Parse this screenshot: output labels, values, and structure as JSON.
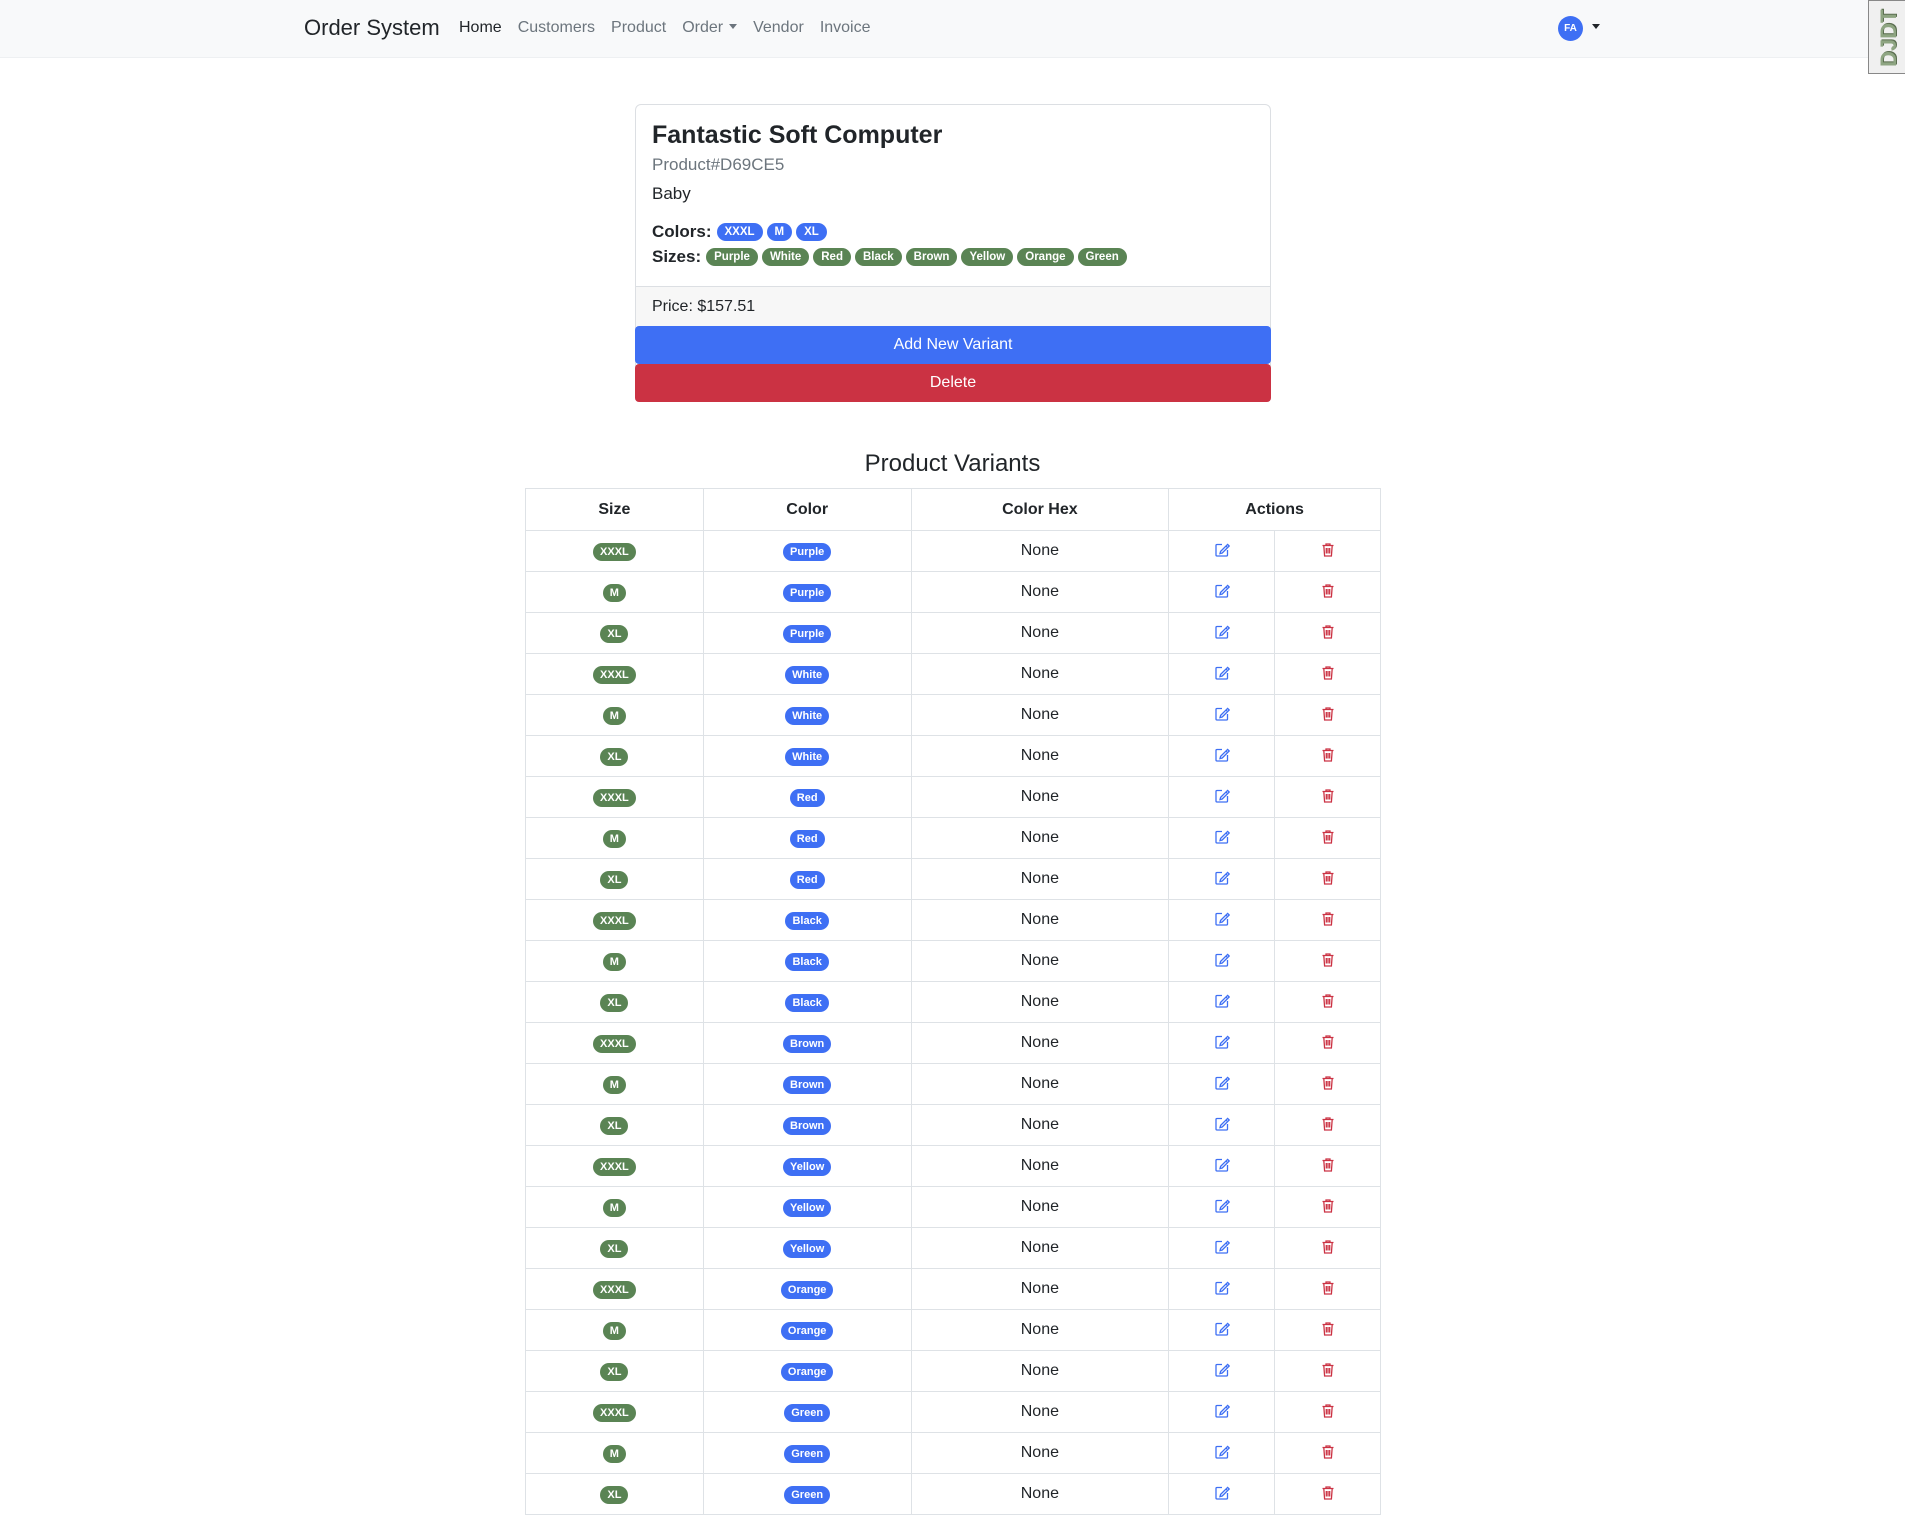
{
  "navbar": {
    "brand": "Order System",
    "links": [
      "Home",
      "Customers",
      "Product",
      "Order",
      "Vendor",
      "Invoice"
    ],
    "active": "Home",
    "avatar_initials": "FA",
    "debug_toolbar_label": "DJDT"
  },
  "product": {
    "name": "Fantastic Soft Computer",
    "code": "Product#D69CE5",
    "category": "Baby",
    "colors_label": "Colors:",
    "colors": [
      "XXXL",
      "M",
      "XL"
    ],
    "sizes_label": "Sizes:",
    "sizes": [
      "Purple",
      "White",
      "Red",
      "Black",
      "Brown",
      "Yellow",
      "Orange",
      "Green"
    ],
    "price": "Price: $157.51",
    "add_variant_label": "Add New Variant",
    "delete_label": "Delete"
  },
  "variants": {
    "title": "Product Variants",
    "columns": [
      "Size",
      "Color",
      "Color Hex",
      "Actions"
    ],
    "rows": [
      {
        "size": "XXXL",
        "color": "Purple",
        "hex": "None"
      },
      {
        "size": "M",
        "color": "Purple",
        "hex": "None"
      },
      {
        "size": "XL",
        "color": "Purple",
        "hex": "None"
      },
      {
        "size": "XXXL",
        "color": "White",
        "hex": "None"
      },
      {
        "size": "M",
        "color": "White",
        "hex": "None"
      },
      {
        "size": "XL",
        "color": "White",
        "hex": "None"
      },
      {
        "size": "XXXL",
        "color": "Red",
        "hex": "None"
      },
      {
        "size": "M",
        "color": "Red",
        "hex": "None"
      },
      {
        "size": "XL",
        "color": "Red",
        "hex": "None"
      },
      {
        "size": "XXXL",
        "color": "Black",
        "hex": "None"
      },
      {
        "size": "M",
        "color": "Black",
        "hex": "None"
      },
      {
        "size": "XL",
        "color": "Black",
        "hex": "None"
      },
      {
        "size": "XXXL",
        "color": "Brown",
        "hex": "None"
      },
      {
        "size": "M",
        "color": "Brown",
        "hex": "None"
      },
      {
        "size": "XL",
        "color": "Brown",
        "hex": "None"
      },
      {
        "size": "XXXL",
        "color": "Yellow",
        "hex": "None"
      },
      {
        "size": "M",
        "color": "Yellow",
        "hex": "None"
      },
      {
        "size": "XL",
        "color": "Yellow",
        "hex": "None"
      },
      {
        "size": "XXXL",
        "color": "Orange",
        "hex": "None"
      },
      {
        "size": "M",
        "color": "Orange",
        "hex": "None"
      },
      {
        "size": "XL",
        "color": "Orange",
        "hex": "None"
      },
      {
        "size": "XXXL",
        "color": "Green",
        "hex": "None"
      },
      {
        "size": "M",
        "color": "Green",
        "hex": "None"
      },
      {
        "size": "XL",
        "color": "Green",
        "hex": "None"
      }
    ],
    "row_actions": {
      "edit_icon": "edit-icon",
      "delete_icon": "trash-icon"
    }
  },
  "theme": {
    "primary": "#3e6ff4",
    "danger": "#cb3243",
    "success_badge": "#5a8454",
    "navbar_bg": "#f8f9fa"
  }
}
